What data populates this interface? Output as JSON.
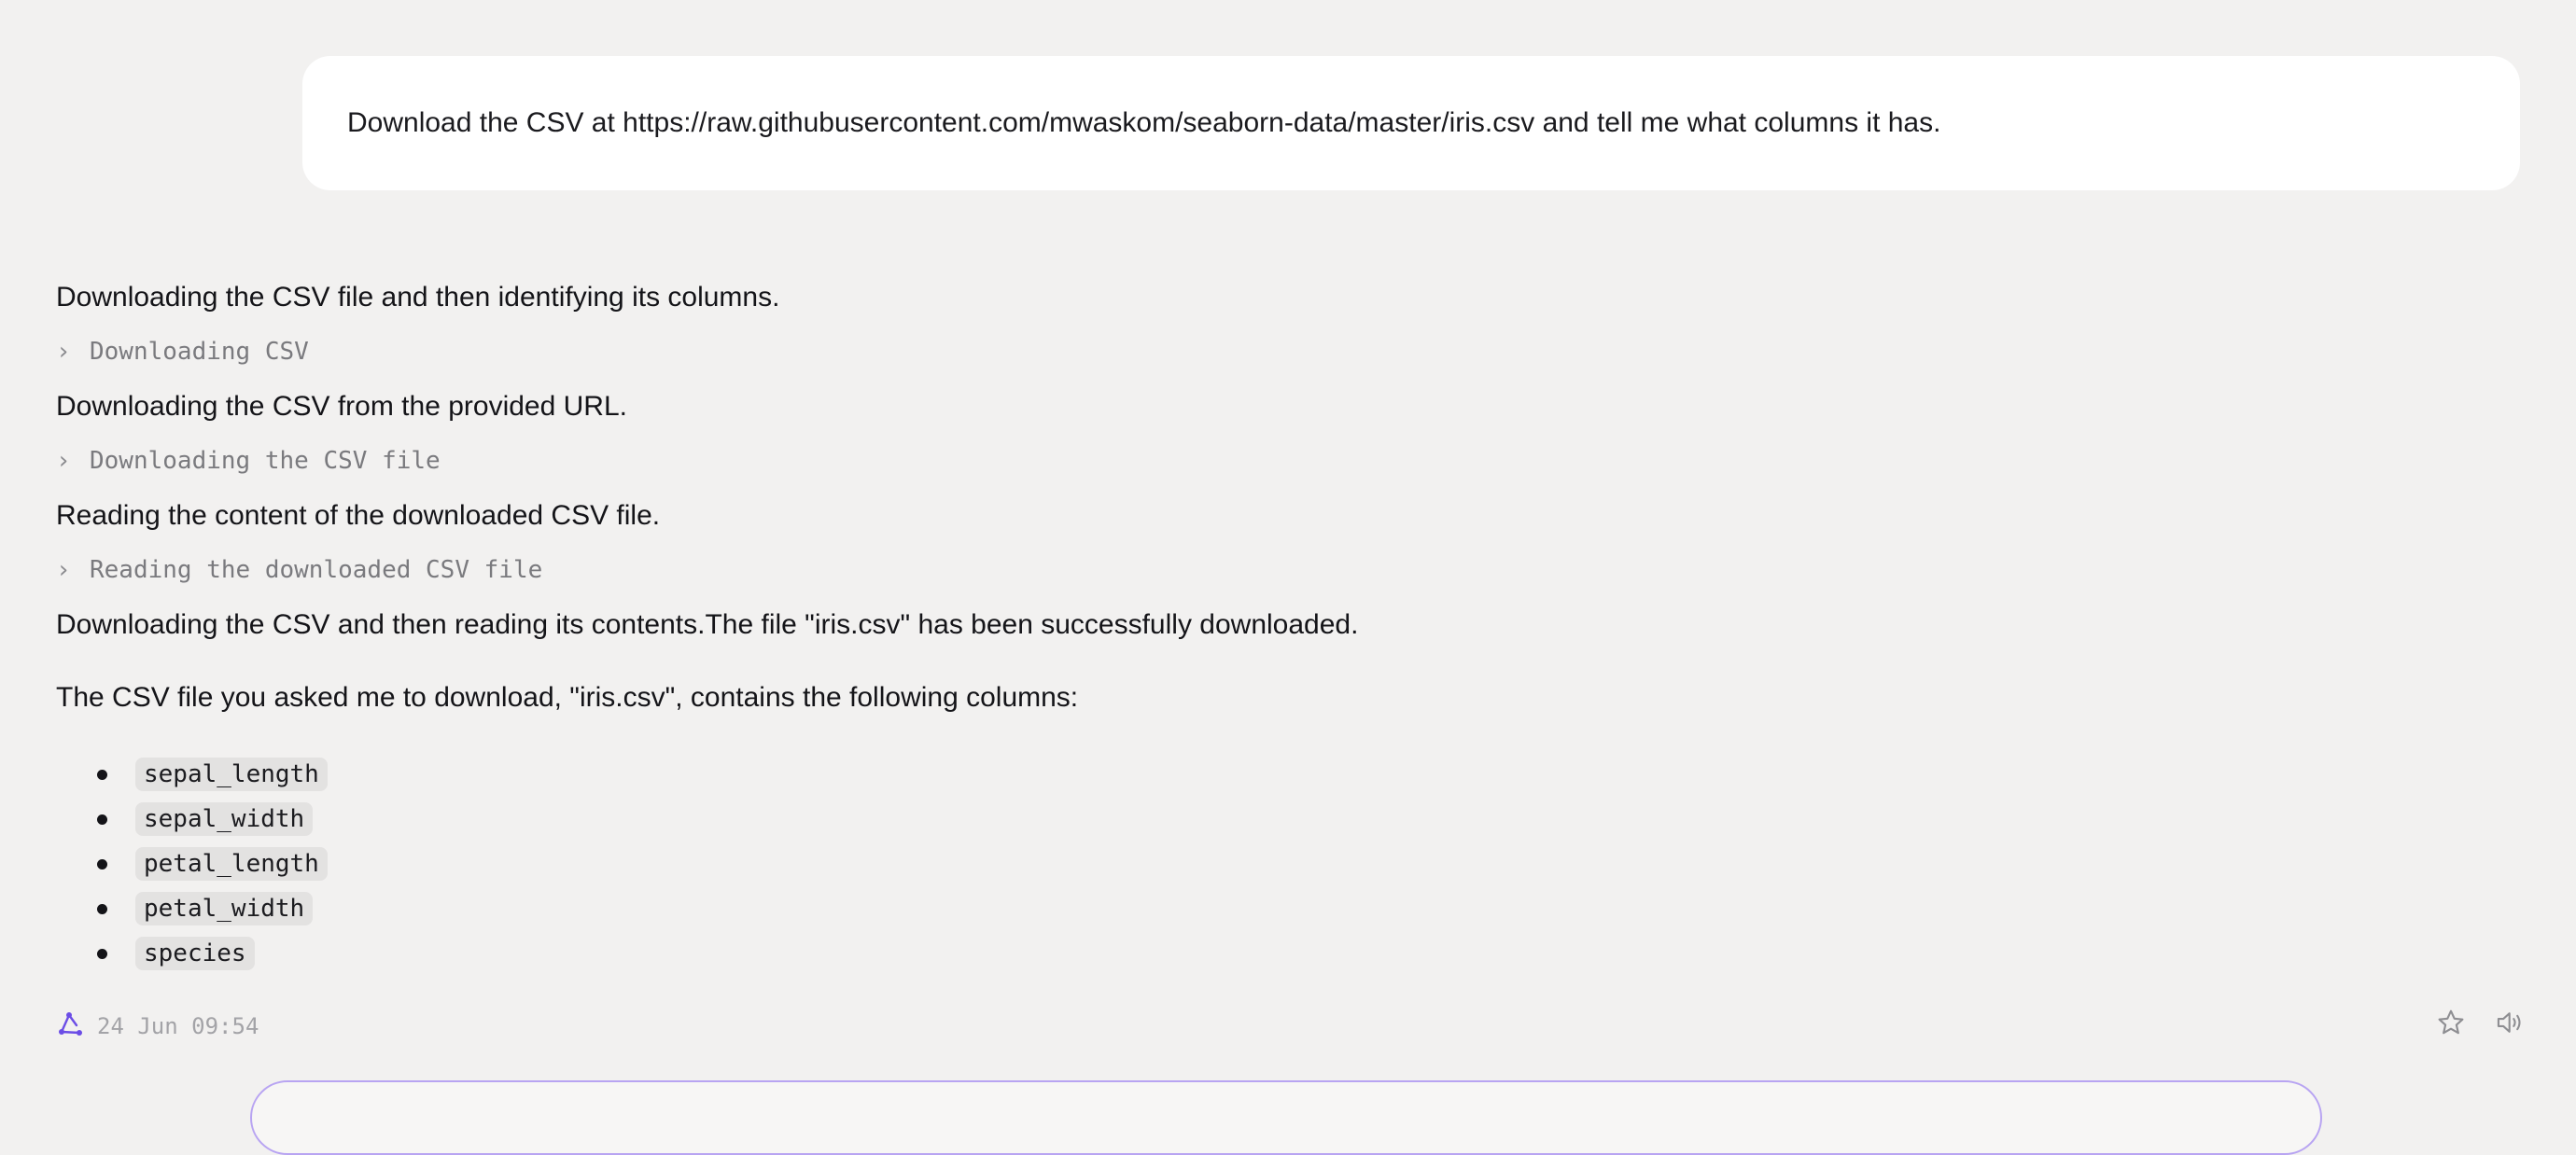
{
  "user_message": {
    "text": "Download the CSV at https://raw.githubusercontent.com/mwaskom/seaborn-data/master/iris.csv and tell me what columns it has."
  },
  "assistant": {
    "narration_1": "Downloading the CSV file and then identifying its columns.",
    "step_1": "Downloading CSV",
    "narration_2": "Downloading the CSV from the provided URL.",
    "step_2": "Downloading the CSV file",
    "narration_3": "Reading the content of the downloaded CSV file.",
    "step_3": "Reading the downloaded CSV file",
    "narration_4": "Downloading the CSV and then reading its contents.The file \"iris.csv\" has been successfully downloaded.",
    "answer_intro": "The CSV file you asked me to download, \"iris.csv\", contains the following columns:",
    "columns": [
      "sepal_length",
      "sepal_width",
      "petal_length",
      "petal_width",
      "species"
    ]
  },
  "meta": {
    "timestamp": "24 Jun 09:54",
    "logo_icon": "assistant-logo-icon",
    "accent_color": "#6b4de6"
  },
  "actions": {
    "star_icon": "star-icon",
    "speaker_icon": "speaker-icon"
  },
  "composer": {
    "border_color": "#b8a4f2"
  }
}
